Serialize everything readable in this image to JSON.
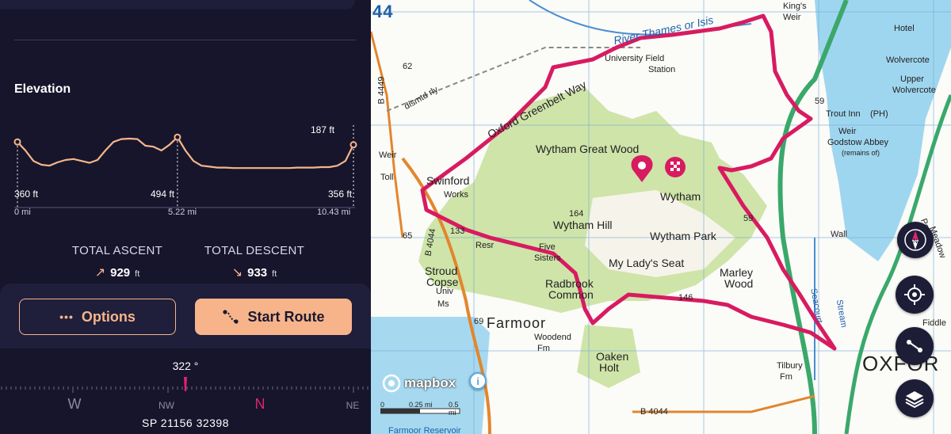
{
  "elevation": {
    "title": "Elevation",
    "max_label": "187 ft",
    "start_elev": "360 ft",
    "mid_elev": "494 ft",
    "end_elev": "356 ft",
    "x_start": "0 mi",
    "x_mid": "5.22 mi",
    "x_end": "10.43 mi",
    "profile": [
      0.12,
      0.3,
      0.52,
      0.6,
      0.62,
      0.55,
      0.5,
      0.48,
      0.52,
      0.56,
      0.5,
      0.3,
      0.12,
      0.06,
      0.05,
      0.06,
      0.2,
      0.22,
      0.3,
      0.18,
      0.02,
      0.3,
      0.52,
      0.62,
      0.64,
      0.66,
      0.66,
      0.67,
      0.67,
      0.67,
      0.67,
      0.67,
      0.67,
      0.67,
      0.67,
      0.66,
      0.66,
      0.66,
      0.65,
      0.65,
      0.62,
      0.52,
      0.18
    ],
    "colors": {
      "line": "#f6b58a",
      "dot": "#f6b58a"
    }
  },
  "stats": {
    "ascent_label": "TOTAL ASCENT",
    "ascent_arrow": "↗",
    "ascent_value": "929",
    "ascent_unit": "ft",
    "descent_label": "TOTAL DESCENT",
    "descent_arrow": "↘",
    "descent_value": "933",
    "descent_unit": "ft"
  },
  "actions": {
    "options_label": "Options",
    "options_icon": "ellipsis-icon",
    "start_label": "Start Route",
    "start_icon": "route-icon"
  },
  "compass": {
    "heading": "322 °",
    "dir_w": "W",
    "dir_nw": "NW",
    "dir_n": "N",
    "dir_ne": "NE",
    "grid_ref": "SP 21156 32398",
    "north_color": "#e0246e"
  },
  "map": {
    "labels": {
      "kings_weir": "King's",
      "kings_weir2": "Weir",
      "hotel": "Hotel",
      "river_thames": "River Thames or Isis",
      "wolvercote": "Wolvercote",
      "upper_wolvercote": "Upper",
      "upper_wolvercote2": "Wolvercote",
      "univ_field": "University Field",
      "station": "Station",
      "trout_inn": "Trout Inn",
      "trout_ph": "(PH)",
      "weir_r": "Weir",
      "godstow": "Godstow Abbey",
      "remains": "(remains of)",
      "port": "Port",
      "meadow": "Meadow",
      "greenbelt": "Oxford Greenbelt Way",
      "wytham_great_wood": "Wytham Great Wood",
      "wytham": "Wytham",
      "weir_l": "Weir",
      "toll": "Toll",
      "swinford": "Swinford",
      "works": "Works",
      "wytham_hill": "Wytham Hill",
      "wytham_park": "Wytham Park",
      "h164": "164",
      "h133": "133",
      "h65": "65",
      "h62": "62",
      "h59a": "59",
      "h59b": "59",
      "h146": "146",
      "h69": "69",
      "stroud": "Stroud",
      "copse": "Copse",
      "univ": "Univ",
      "ms": "Ms",
      "five": "Five",
      "sisters": "Sisters",
      "ladys_seat": "My Lady's Seat",
      "radbrook": "Radbrook",
      "common": "Common",
      "marley": "Marley",
      "wood": "Wood",
      "farmoor": "Farmoor",
      "woodend": "Woodend",
      "fm": "Fm",
      "oaken": "Oaken",
      "holt": "Holt",
      "tilbury": "Tilbury",
      "tilbury_fm": "Fm",
      "oxford": "OXFOR",
      "b4044": "B 4044",
      "b4044b": "B 4044",
      "b4449": "B 4449",
      "seacourt": "Seacourt",
      "stream": "Stream",
      "farmoor_res": "Farmoor Reservoir",
      "resr": "Resr",
      "fiddler": "Fiddle",
      "wall": "Wall",
      "grid44": "44",
      "dismtd": "dismtd rly",
      "hl": "PH"
    },
    "mapbox": "mapbox",
    "scale_0": "0",
    "scale_025": "0.25 mi",
    "scale_05": "0.5 mi",
    "route_color": "#d81b60",
    "controls": [
      "compass-icon",
      "locate-icon",
      "route-edit-icon",
      "layers-icon"
    ]
  }
}
